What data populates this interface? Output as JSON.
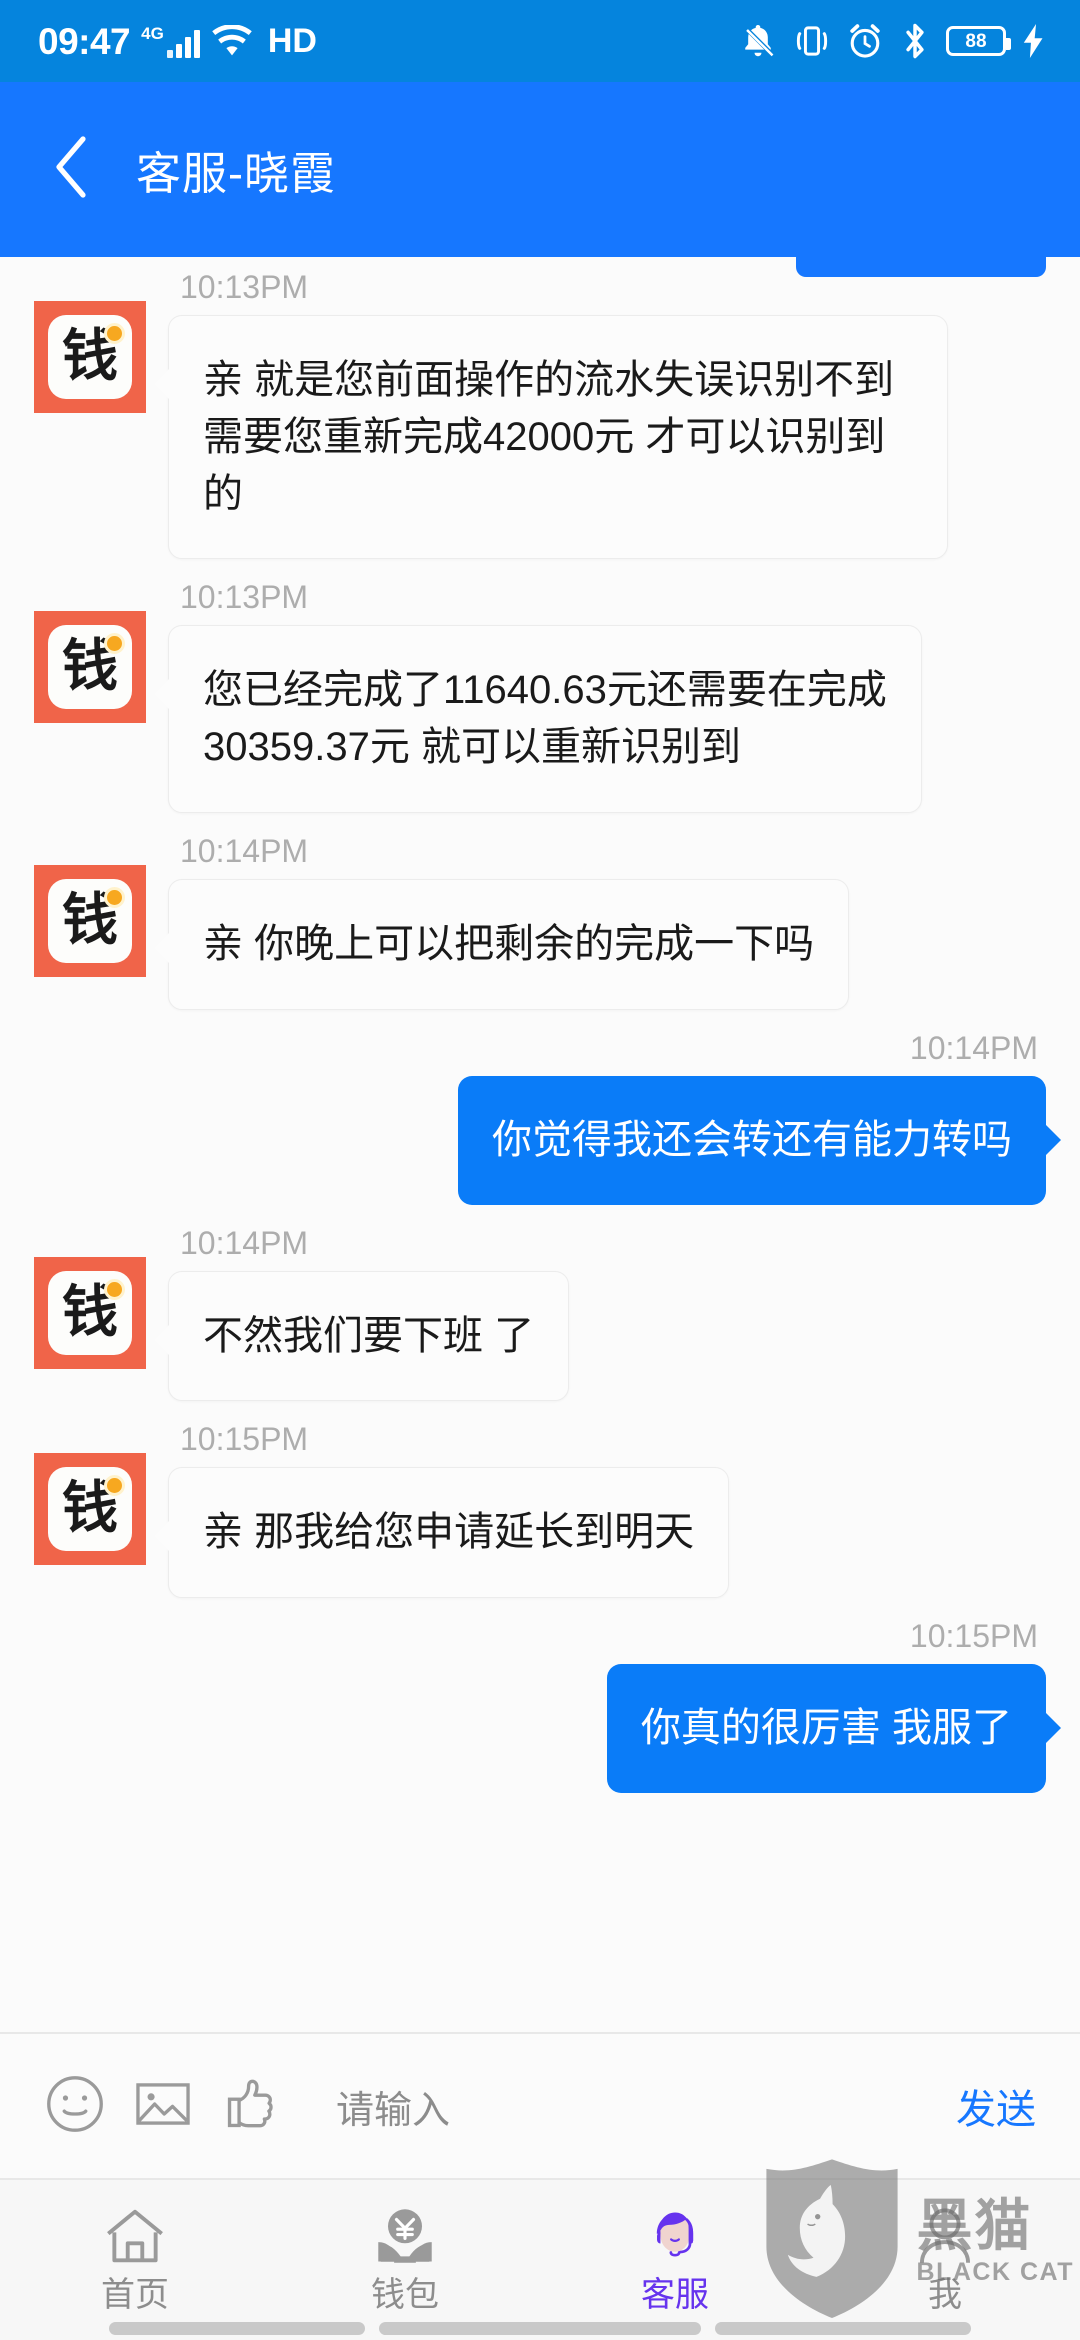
{
  "statusbar": {
    "time": "09:47",
    "network_label": "4G",
    "hd_label": "HD",
    "battery_level": "88",
    "icons": [
      "mute-bell-icon",
      "vibrate-icon",
      "alarm-clock-icon",
      "bluetooth-icon",
      "battery-icon",
      "charging-bolt-icon"
    ]
  },
  "header": {
    "title": "客服-晓霞",
    "back_icon": "chevron-left-icon",
    "bg_color": "#1677ff"
  },
  "avatar": {
    "glyph": "钱",
    "bg_color": "#f06449"
  },
  "messages": [
    {
      "side": "in",
      "time": "10:13PM",
      "lines": [
        "亲 就是您前面操作的流水失误识别不到",
        "需要您重新完成42000元 才可以识别到的"
      ]
    },
    {
      "side": "in",
      "time": "10:13PM",
      "lines": [
        "您已经完成了11640.63元还需要在完成",
        "30359.37元 就可以重新识别到"
      ]
    },
    {
      "side": "in",
      "time": "10:14PM",
      "lines": [
        "亲 你晚上可以把剩余的完成一下吗"
      ]
    },
    {
      "side": "out",
      "time": "10:14PM",
      "lines": [
        "你觉得我还会转还有能力转吗"
      ]
    },
    {
      "side": "in",
      "time": "10:14PM",
      "lines": [
        "不然我们要下班 了"
      ]
    },
    {
      "side": "in",
      "time": "10:15PM",
      "lines": [
        "亲 那我给您申请延长到明天"
      ]
    },
    {
      "side": "out",
      "time": "10:15PM",
      "lines": [
        "你真的很厉害 我服了"
      ]
    }
  ],
  "input_bar": {
    "placeholder": "请输入",
    "value": "",
    "send_label": "发送",
    "icons": [
      "emoji-icon",
      "image-icon",
      "thumbs-up-icon"
    ],
    "send_color": "#1677ff"
  },
  "bottom_nav": {
    "items": [
      {
        "label": "首页",
        "icon": "home-icon",
        "active": false
      },
      {
        "label": "钱包",
        "icon": "wallet-icon",
        "active": false
      },
      {
        "label": "客服",
        "icon": "headset-support-icon",
        "active": true
      },
      {
        "label": "我",
        "icon": "person-icon",
        "active": false
      }
    ],
    "active_color": "#6633ee",
    "inactive_color": "#8d8d8d"
  },
  "watermark": {
    "cn": "黑猫",
    "en": "BLACK CAT",
    "icon": "shield-cat-logo"
  }
}
